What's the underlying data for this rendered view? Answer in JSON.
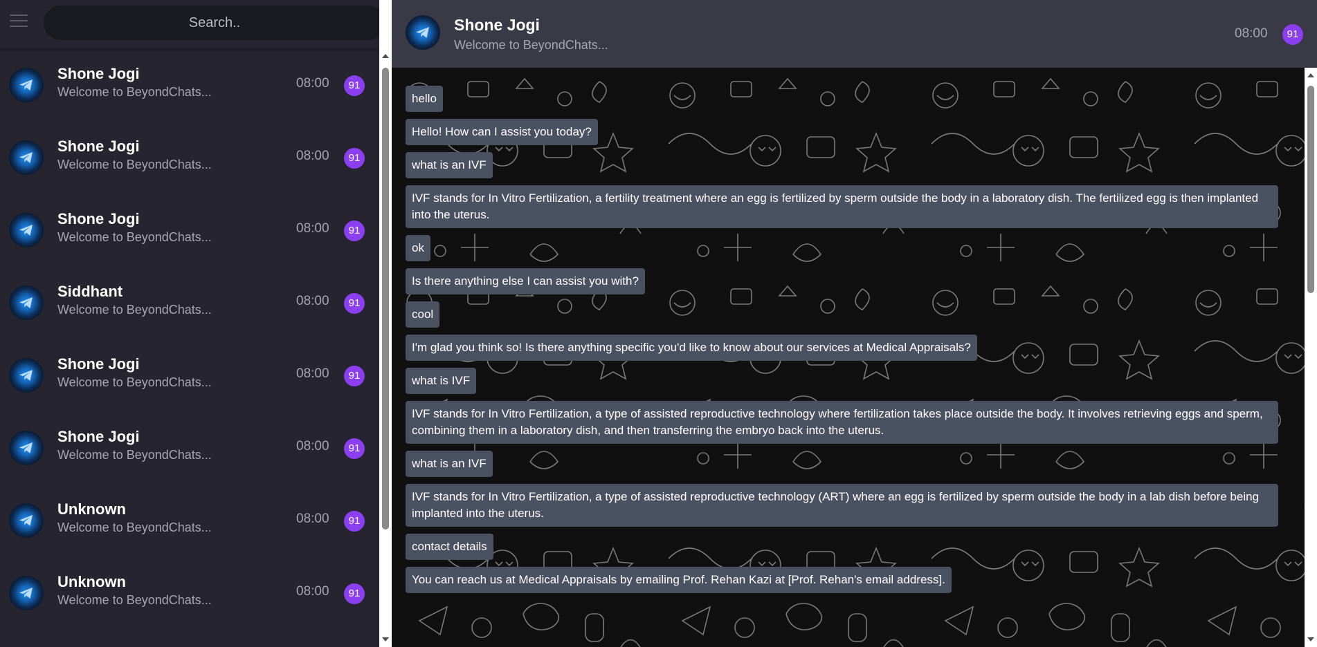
{
  "search": {
    "placeholder": "Search.."
  },
  "chats": [
    {
      "name": "Shone Jogi",
      "preview": "Welcome to BeyondChats...",
      "time": "08:00",
      "unread": "91"
    },
    {
      "name": "Shone Jogi",
      "preview": "Welcome to BeyondChats...",
      "time": "08:00",
      "unread": "91"
    },
    {
      "name": "Shone Jogi",
      "preview": "Welcome to BeyondChats...",
      "time": "08:00",
      "unread": "91"
    },
    {
      "name": "Siddhant",
      "preview": "Welcome to BeyondChats...",
      "time": "08:00",
      "unread": "91"
    },
    {
      "name": "Shone Jogi",
      "preview": "Welcome to BeyondChats...",
      "time": "08:00",
      "unread": "91"
    },
    {
      "name": "Shone Jogi",
      "preview": "Welcome to BeyondChats...",
      "time": "08:00",
      "unread": "91"
    },
    {
      "name": "Unknown",
      "preview": "Welcome to BeyondChats...",
      "time": "08:00",
      "unread": "91"
    },
    {
      "name": "Unknown",
      "preview": "Welcome to BeyondChats...",
      "time": "08:00",
      "unread": "91"
    }
  ],
  "header": {
    "name": "Shone Jogi",
    "subtitle": "Welcome to BeyondChats...",
    "time": "08:00",
    "unread": "91"
  },
  "messages": [
    "hello",
    "Hello! How can I assist you today?",
    "what is an IVF",
    "IVF stands for In Vitro Fertilization, a fertility treatment where an egg is fertilized by sperm outside the body in a laboratory dish. The fertilized egg is then implanted into the uterus.",
    "ok",
    "Is there anything else I can assist you with?",
    "cool",
    "I'm glad you think so! Is there anything specific you'd like to know about our services at Medical Appraisals?",
    "what is IVF",
    "IVF stands for In Vitro Fertilization, a type of assisted reproductive technology where fertilization takes place outside the body. It involves retrieving eggs and sperm, combining them in a laboratory dish, and then transferring the embryo back into the uterus.",
    "what is an IVF",
    "IVF stands for In Vitro Fertilization, a type of assisted reproductive technology (ART) where an egg is fertilized by sperm outside the body in a lab dish before being implanted into the uterus.",
    "contact details",
    "You can reach us at Medical Appraisals by emailing Prof. Rehan Kazi at [Prof. Rehan's email address]."
  ],
  "icons": {
    "menu": "hamburger-menu-icon",
    "avatar": "telegram-plane-icon"
  },
  "colors": {
    "sidebar_bg": "#26252f",
    "header_bg": "#3a3946",
    "bubble_bg": "#4a5160",
    "badge_bg": "#8b3ff0"
  }
}
